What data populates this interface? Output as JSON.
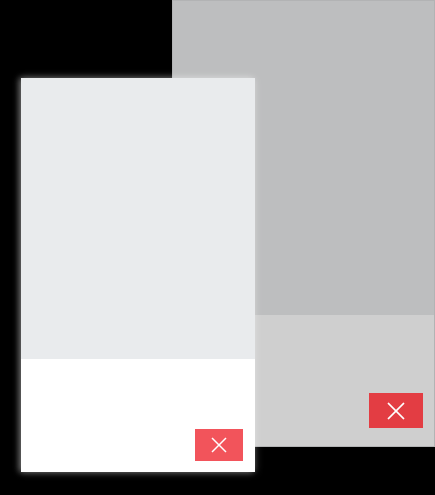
{
  "windows": [
    {
      "id": "back",
      "close_button": {
        "icon": "close-icon",
        "color": "#e33d43"
      },
      "colors": {
        "body": "#bdbebf",
        "footer": "#cfcfcf"
      }
    },
    {
      "id": "front",
      "close_button": {
        "icon": "close-icon",
        "color": "#f2545b"
      },
      "colors": {
        "body": "#e9ebed",
        "footer": "#ffffff"
      }
    }
  ],
  "background_color": "#000000"
}
